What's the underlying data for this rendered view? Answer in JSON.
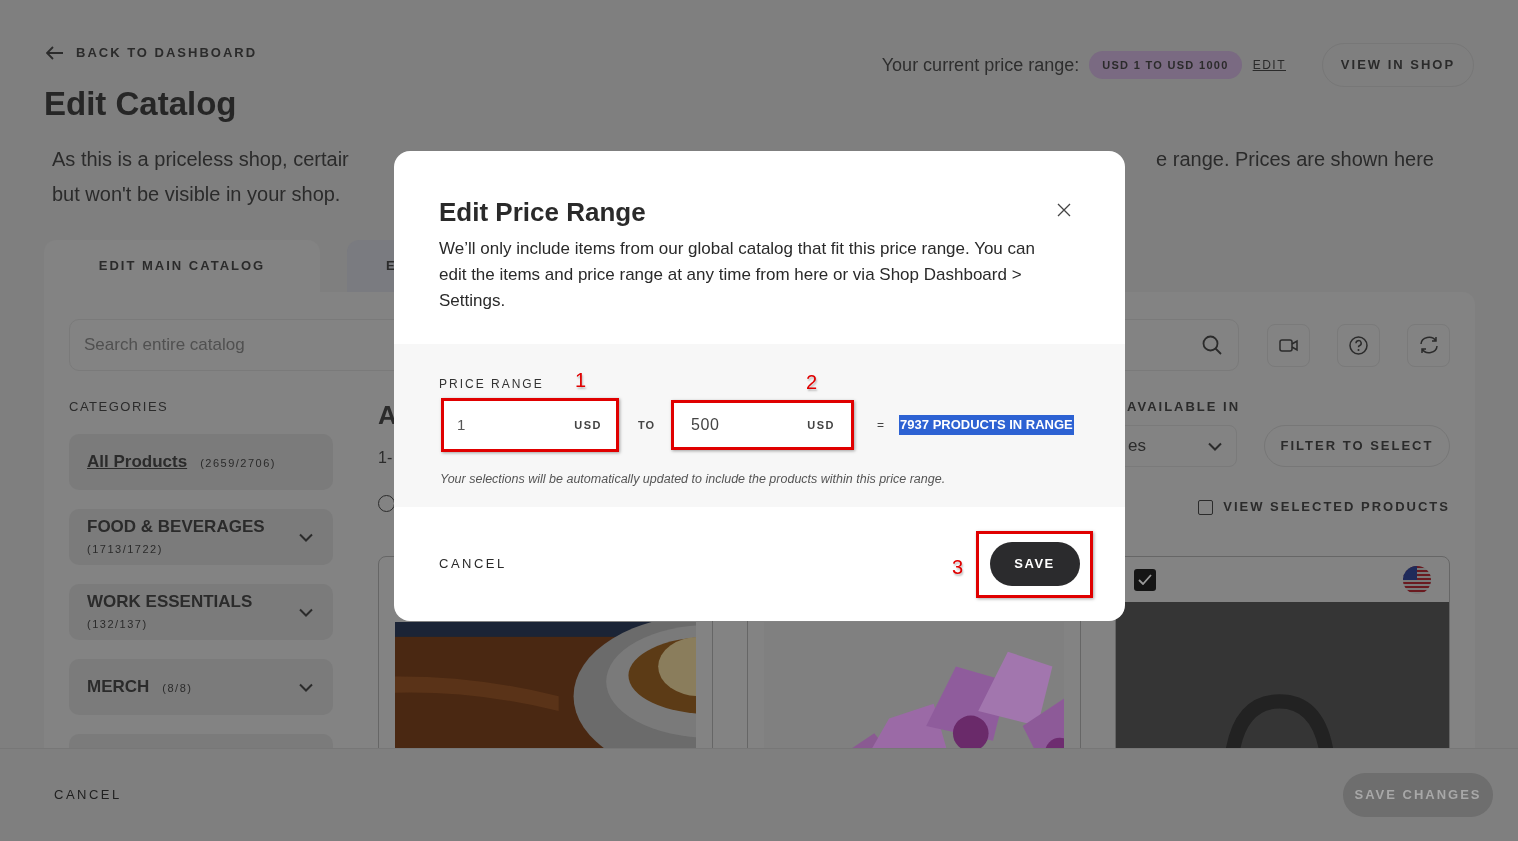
{
  "back_link": {
    "label": "BACK TO DASHBOARD"
  },
  "title": "Edit Catalog",
  "price_range_summary": {
    "label": "Your current price range:",
    "badge": "USD 1 TO USD 1000",
    "edit_link": "EDIT"
  },
  "view_in_shop": "VIEW IN SHOP",
  "description": {
    "line_1_left": "As this is a priceless shop, certair",
    "line_1_right": "e range. Prices are shown here",
    "line_2": "but won't be visible in your shop."
  },
  "tabs": [
    {
      "label": "EDIT MAIN CATALOG",
      "selected": true
    },
    {
      "label": "E",
      "selected": false
    }
  ],
  "search": {
    "placeholder": "Search entire catalog"
  },
  "categories": {
    "heading": "CATEGORIES",
    "items": [
      {
        "name": "All Products",
        "count": "(2659/2706)",
        "kind": "link"
      },
      {
        "name": "FOOD & BEVERAGES",
        "count": "(1713/1722)",
        "kind": "group_stacked"
      },
      {
        "name": "WORK ESSENTIALS",
        "count": "(132/137)",
        "kind": "group_stacked"
      },
      {
        "name": "MERCH",
        "count": "(8/8)",
        "kind": "group_inline"
      },
      {
        "kind": "group_cut"
      }
    ]
  },
  "listing": {
    "heading": "A",
    "range_text": "1-",
    "radio_selected": false
  },
  "availability": {
    "label": "AVAILABLE IN",
    "dropdown_value": "es",
    "filter_button": "FILTER TO SELECT",
    "view_selected": {
      "label": "VIEW SELECTED PRODUCTS",
      "checked": false
    }
  },
  "products": [
    {
      "kind": "picture"
    },
    {
      "kind": "picture"
    },
    {
      "kind": "picture",
      "checked": true
    }
  ],
  "footer": {
    "cancel": "CANCEL",
    "save": {
      "label": "SAVE CHANGES",
      "disabled": true
    }
  },
  "dialog": {
    "title": "Edit Price Range",
    "text": "We’ll only include items from our global catalog that fit this price range. You can edit the items and price range at any time from here or via Shop Dashboard > Settings.",
    "price_range": {
      "label": "PRICE RANGE",
      "min": {
        "value": "1",
        "unit": "USD"
      },
      "separator": "TO",
      "max": {
        "value": "500",
        "unit": "USD"
      },
      "equals": "=",
      "result": "7937 PRODUCTS IN RANGE",
      "result_selected": true,
      "note": "Your selections will be automatically updated to include the products within this price range."
    },
    "cancel": "CANCEL",
    "save": "SAVE"
  },
  "annotations": [
    {
      "label": "1"
    },
    {
      "label": "2"
    },
    {
      "label": "3"
    }
  ]
}
